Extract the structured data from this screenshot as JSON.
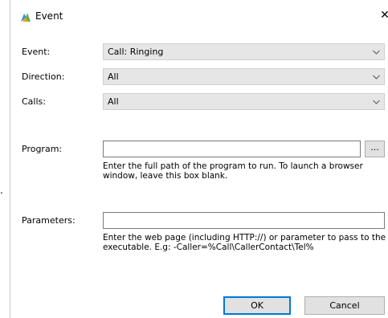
{
  "window": {
    "title": "Event",
    "close_glyph": "✕",
    "icon": "event-app-icon"
  },
  "stray_text": ".",
  "fields": {
    "event": {
      "label": "Event:",
      "value": "Call: Ringing"
    },
    "direction": {
      "label": "Direction:",
      "value": "All"
    },
    "calls": {
      "label": "Calls:",
      "value": "All"
    },
    "program": {
      "label": "Program:",
      "value": "",
      "browse_label": "...",
      "help": "Enter the full path of the program to run. To launch a browser window, leave this box blank."
    },
    "parameters": {
      "label": "Parameters:",
      "value": "",
      "help": "Enter the web page (including HTTP://) or parameter to pass to the executable. E.g: -Caller=%Call\\CallerContact\\Tel%"
    }
  },
  "buttons": {
    "ok": "OK",
    "cancel": "Cancel"
  },
  "colors": {
    "accent": "#0078d7",
    "combo_bg": "#e6e6e6",
    "button_bg": "#e1e1e1"
  }
}
